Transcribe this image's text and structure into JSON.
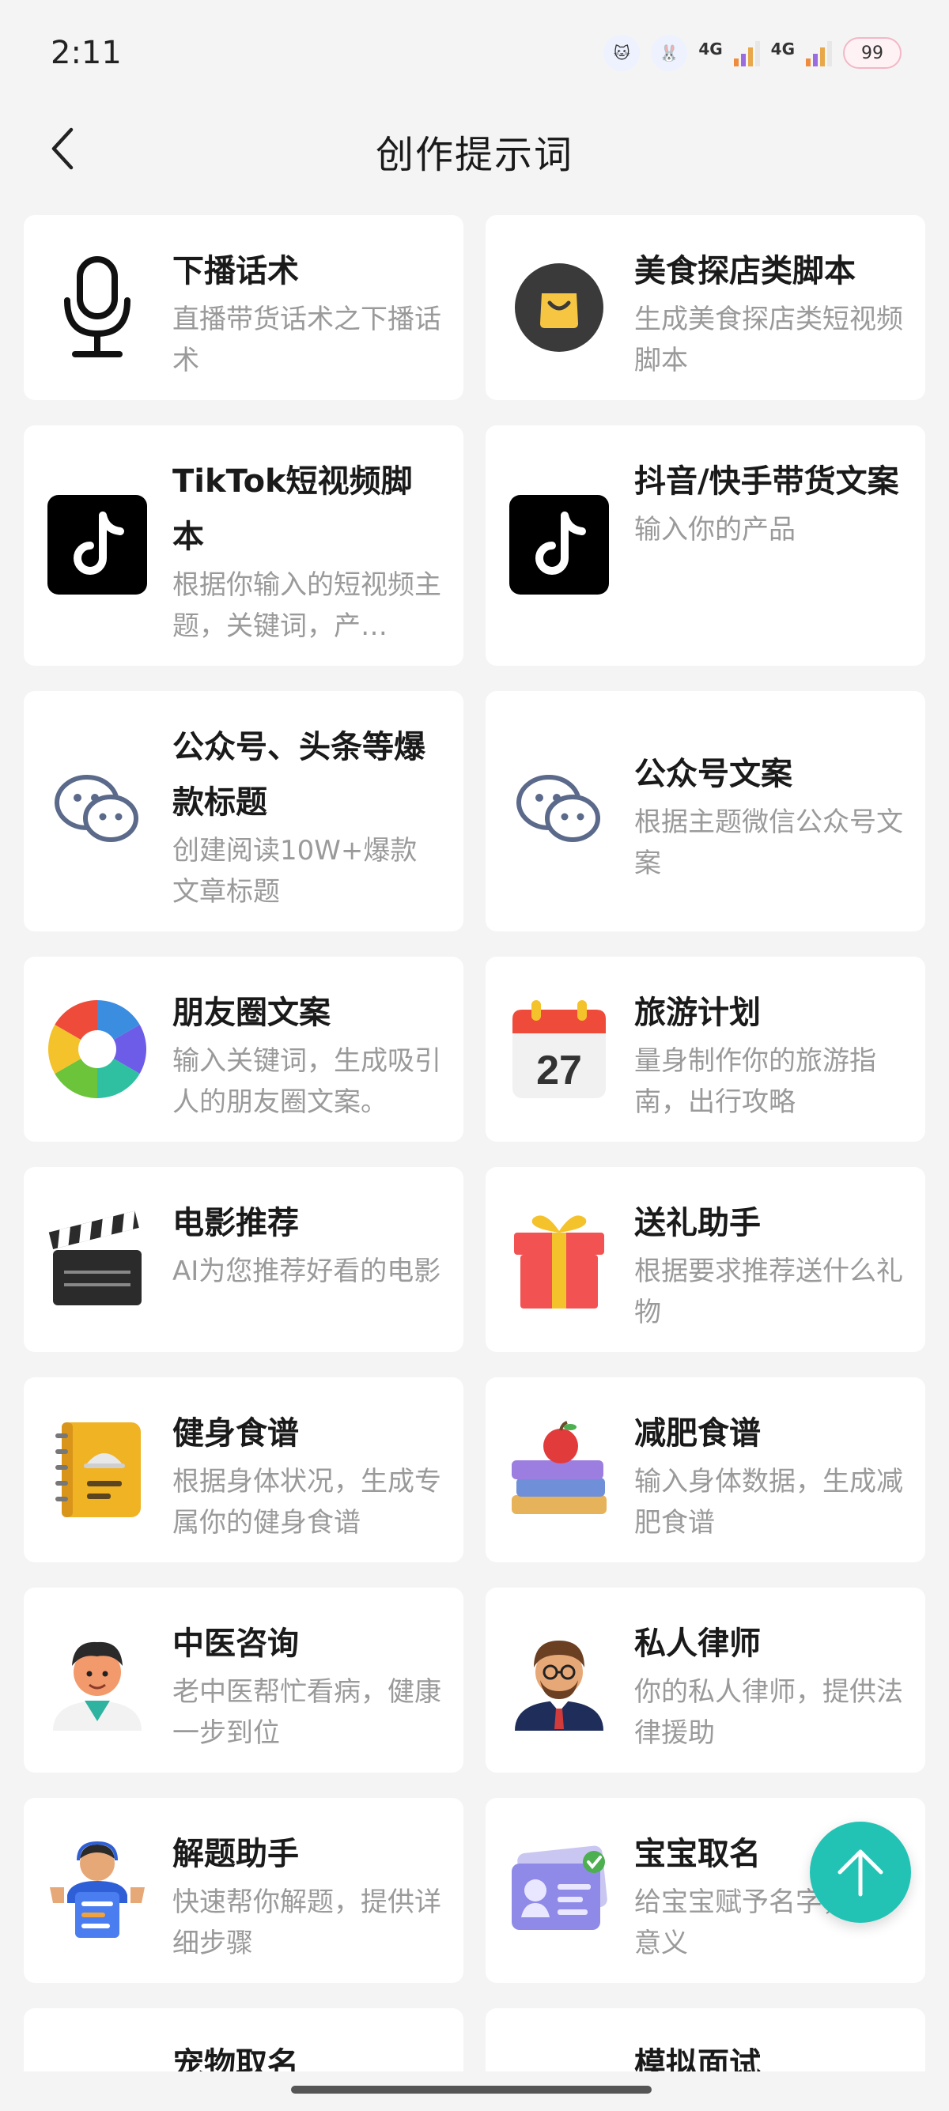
{
  "status": {
    "time": "2:11",
    "net1": "4G",
    "net2": "4G",
    "battery": "99"
  },
  "header": {
    "title": "创作提示词",
    "back_icon": "chevron-left-icon"
  },
  "cards": [
    {
      "title": "下播话术",
      "desc": "直播带货话术之下播话术",
      "icon": "microphone-icon"
    },
    {
      "title": "美食探店类脚本",
      "desc": "生成美食探店类短视频脚本",
      "icon": "shopping-bag-icon"
    },
    {
      "title": "TikTok短视频脚本",
      "desc": "根据你输入的短视频主题，关键词，产…",
      "icon": "tiktok-icon"
    },
    {
      "title": "抖音/快手带货文案",
      "desc": "输入你的产品",
      "icon": "tiktok-icon"
    },
    {
      "title": "公众号、头条等爆款标题",
      "desc": "创建阅读10W+爆款文章标题",
      "icon": "wechat-icon"
    },
    {
      "title": "公众号文案",
      "desc": "根据主题微信公众号文案",
      "icon": "wechat-icon"
    },
    {
      "title": "朋友圈文案",
      "desc": "输入关键词，生成吸引人的朋友圈文案。",
      "icon": "aperture-icon"
    },
    {
      "title": "旅游计划",
      "desc": "量身制作你的旅游指南，出行攻略",
      "icon": "calendar-icon",
      "calendar_day": "27"
    },
    {
      "title": "电影推荐",
      "desc": "AI为您推荐好看的电影",
      "icon": "clapperboard-icon"
    },
    {
      "title": "送礼助手",
      "desc": "根据要求推荐送什么礼物",
      "icon": "gift-icon"
    },
    {
      "title": "健身食谱",
      "desc": "根据身体状况，生成专属你的健身食谱",
      "icon": "recipe-book-icon"
    },
    {
      "title": "减肥食谱",
      "desc": "输入身体数据，生成减肥食谱",
      "icon": "books-apple-icon"
    },
    {
      "title": "中医咨询",
      "desc": "老中医帮忙看病，健康一步到位",
      "icon": "doctor-avatar-icon"
    },
    {
      "title": "私人律师",
      "desc": "你的私人律师，提供法律援助",
      "icon": "lawyer-avatar-icon"
    },
    {
      "title": "解题助手",
      "desc": "快速帮你解题，提供详细步骤",
      "icon": "tutor-avatar-icon"
    },
    {
      "title": "宝宝取名",
      "desc": "给宝宝赋予名字，赋予意义",
      "icon": "id-card-icon"
    },
    {
      "title": "宠物取名",
      "desc": "",
      "icon": "pet-icon"
    },
    {
      "title": "模拟面试",
      "desc": "",
      "icon": "interview-icon"
    }
  ],
  "fab": {
    "icon": "arrow-up-icon"
  }
}
